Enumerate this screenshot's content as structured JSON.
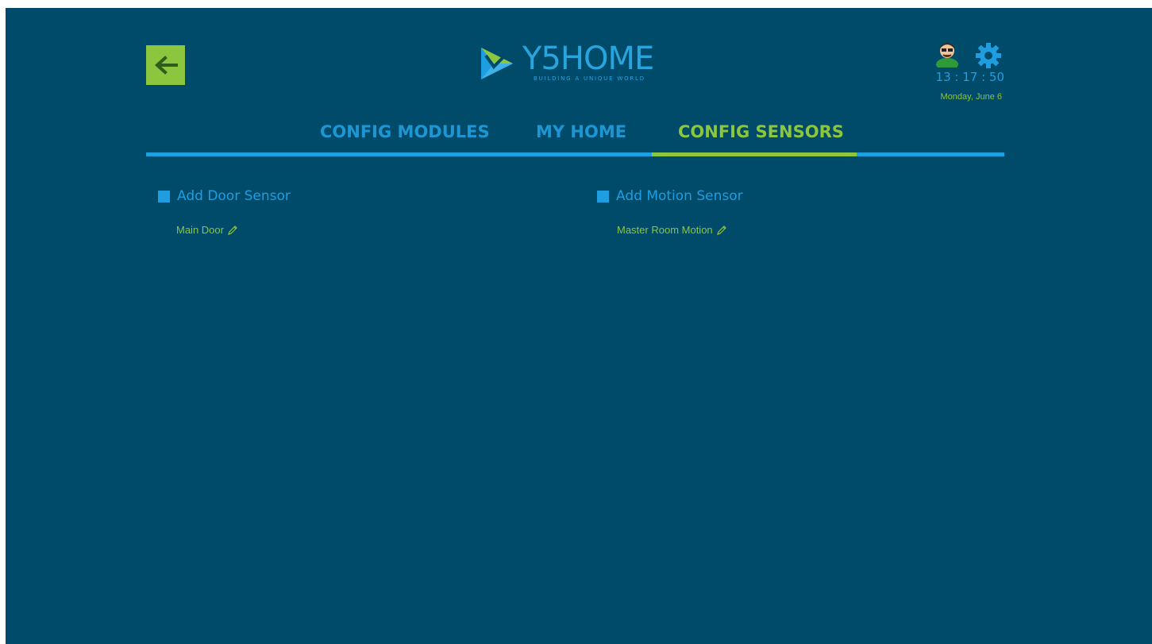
{
  "header": {
    "back_icon": "arrow-left-icon",
    "logo_text": "Y5HOME",
    "logo_tagline": "BUILDING A UNIQUE WORLD",
    "time": "13 : 17 : 50",
    "date": "Monday, June 6",
    "avatar_icon": "user-avatar-icon",
    "settings_icon": "gear-icon"
  },
  "tabs": [
    {
      "label": "CONFIG MODULES",
      "active": false
    },
    {
      "label": "MY HOME",
      "active": false
    },
    {
      "label": "CONFIG SENSORS",
      "active": true
    }
  ],
  "sections": {
    "door": {
      "title": "Add Door Sensor",
      "items": [
        {
          "label": "Main Door",
          "icon": "pencil-icon"
        }
      ]
    },
    "motion": {
      "title": "Add Motion Sensor",
      "items": [
        {
          "label": "Master Room Motion",
          "icon": "pencil-icon"
        }
      ]
    }
  },
  "colors": {
    "background": "#004a6a",
    "accent_blue": "#1ea0e0",
    "accent_green": "#8cc63f"
  }
}
